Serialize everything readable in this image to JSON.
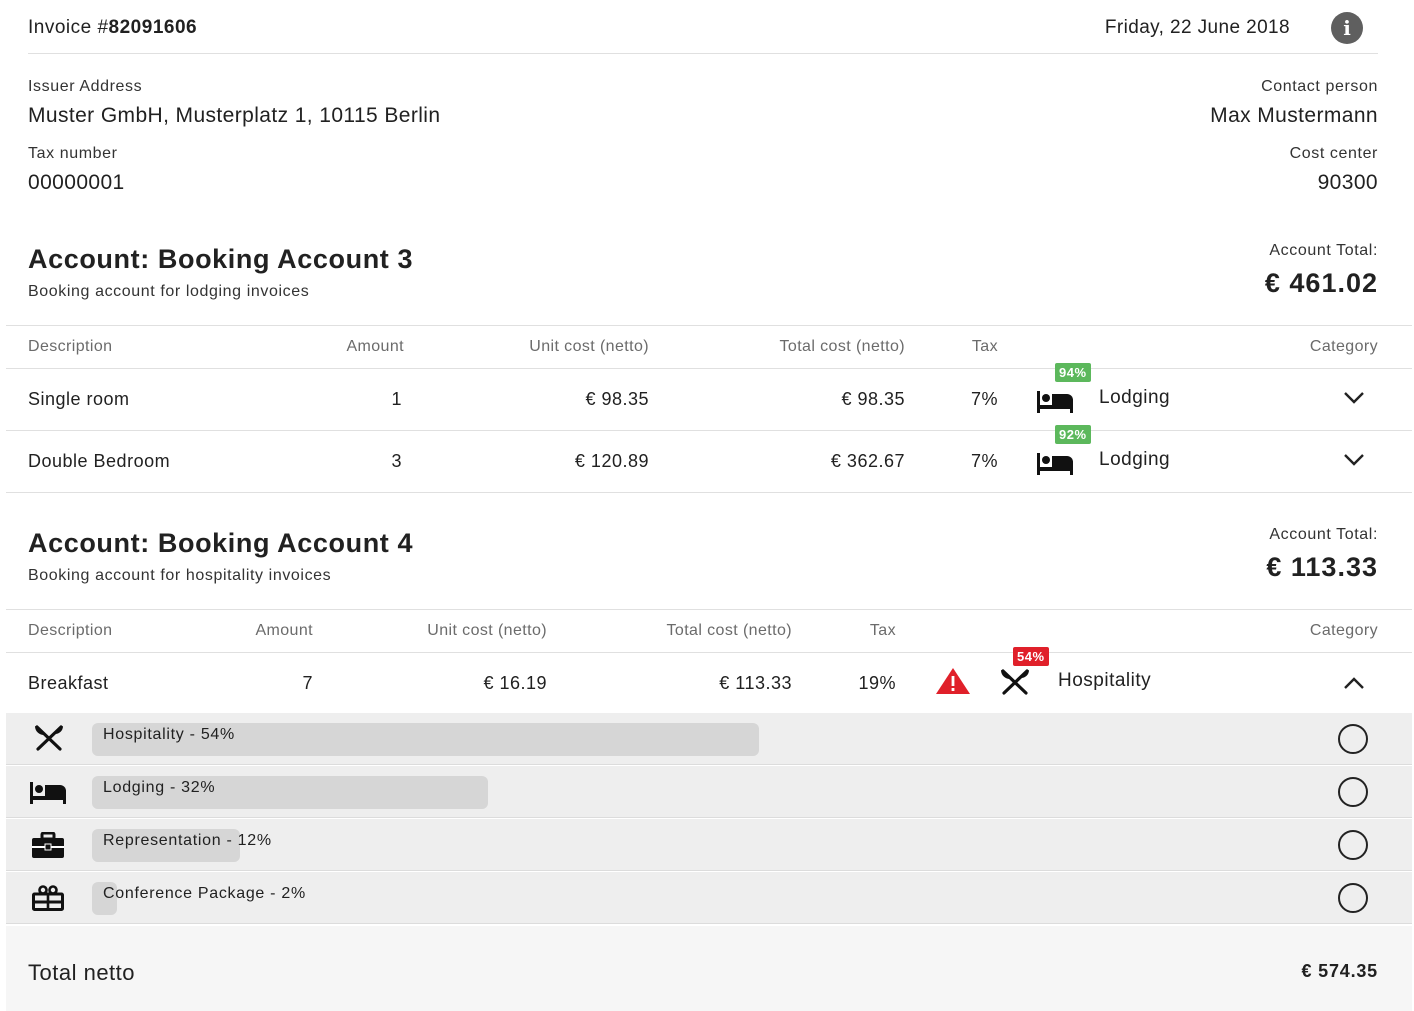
{
  "header": {
    "invoice_prefix": "Invoice #",
    "invoice_number": "82091606",
    "date": "Friday, 22 June 2018",
    "info_icon": "info-icon"
  },
  "issuer": {
    "address_label": "Issuer Address",
    "address": "Muster GmbH, Musterplatz 1, 10115 Berlin",
    "tax_label": "Tax number",
    "tax_number": "00000001",
    "contact_label": "Contact person",
    "contact": "Max Mustermann",
    "cost_center_label": "Cost center",
    "cost_center": "90300"
  },
  "accounts": [
    {
      "title": "Account: Booking Account 3",
      "subtitle": "Booking account for lodging invoices",
      "total_label": "Account Total:",
      "total": "€ 461.02",
      "columns": [
        "Description",
        "Amount",
        "Unit cost (netto)",
        "Total cost (netto)",
        "Tax",
        "Category"
      ],
      "rows": [
        {
          "description": "Single room",
          "amount": "1",
          "unit_cost": "€ 98.35",
          "total_cost": "€ 98.35",
          "tax": "7%",
          "confidence": "94%",
          "category": "Lodging",
          "icon": "bed-icon"
        },
        {
          "description": "Double Bedroom",
          "amount": "3",
          "unit_cost": "€ 120.89",
          "total_cost": "€ 362.67",
          "tax": "7%",
          "confidence": "92%",
          "category": "Lodging",
          "icon": "bed-icon"
        }
      ]
    },
    {
      "title": "Account: Booking Account 4",
      "subtitle": "Booking account for hospitality invoices",
      "total_label": "Account Total:",
      "total": "€ 113.33",
      "columns": [
        "Description",
        "Amount",
        "Unit cost (netto)",
        "Total cost (netto)",
        "Tax",
        "Category"
      ],
      "rows": [
        {
          "description": "Breakfast",
          "amount": "7",
          "unit_cost": "€ 16.19",
          "total_cost": "€ 113.33",
          "tax": "19%",
          "confidence": "54%",
          "category": "Hospitality",
          "icon": "cutlery-icon",
          "warning": true
        }
      ],
      "suggestions": [
        {
          "label": "Hospitality - 54%",
          "value": 0.54,
          "icon": "cutlery-icon"
        },
        {
          "label": "Lodging - 32%",
          "value": 0.32,
          "icon": "bed-icon"
        },
        {
          "label": "Representation - 12%",
          "value": 0.12,
          "icon": "briefcase-icon"
        },
        {
          "label": "Conference Package - 2%",
          "value": 0.02,
          "icon": "gift-icon"
        }
      ]
    }
  ],
  "footer": {
    "total_label": "Total netto",
    "total": "€ 574.35"
  },
  "colors": {
    "badge_high": "#5cb85c",
    "badge_low": "#e0202a",
    "warning": "#e0202a"
  }
}
